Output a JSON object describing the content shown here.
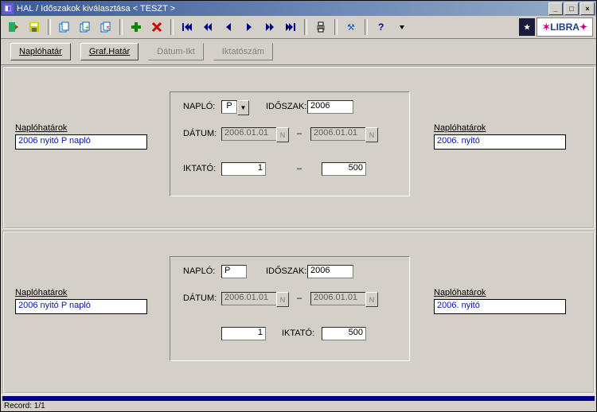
{
  "titlebar": {
    "title": "HAL /  Időszakok kiválasztása   < TESZT >"
  },
  "logos": {
    "dark": "★",
    "libra": "LIBRA"
  },
  "subButtons": {
    "naplohatar": "Naplóhatár",
    "grafhatar": "Graf.Határ",
    "datumikt": "Dátum-Ikt",
    "iktatoszam": "Iktatószám"
  },
  "upper": {
    "leftLabel": "Naplóhatárok",
    "leftValue": "2006 nyitó P napló",
    "rightLabel": "Naplóhatárok",
    "rightValue": "2006. nyitó",
    "panel": {
      "naploLabel": "NAPLÓ:",
      "naploValue": "P",
      "idoszakLabel": "IDŐSZAK:",
      "idoszakValue": "2006",
      "datumLabel": "DÁTUM:",
      "datumFrom": "2006.01.01",
      "datumTo": "2006.01.01",
      "iktatoLabel": "IKTATÓ:",
      "iktatoFrom": "1",
      "iktatoTo": "500",
      "dash": "–"
    }
  },
  "lower": {
    "leftLabel": "Naplóhatárok",
    "leftValue": "2006 nyitó P napló",
    "rightLabel": "Naplóhatárok",
    "rightValue": "2006. nyitó",
    "panel": {
      "naploLabel": "NAPLÓ:",
      "naploValue": "P",
      "idoszakLabel": "IDŐSZAK:",
      "idoszakValue": "2006",
      "datumLabel": "DÁTUM:",
      "datumFrom": "2006.01.01",
      "datumTo": "2006.01.01",
      "iktatoLabel": "IKTATÓ:",
      "iktatoFrom": "1",
      "iktatoTo": "500",
      "dash": "–"
    }
  },
  "status": {
    "record": "Record: 1/1"
  }
}
